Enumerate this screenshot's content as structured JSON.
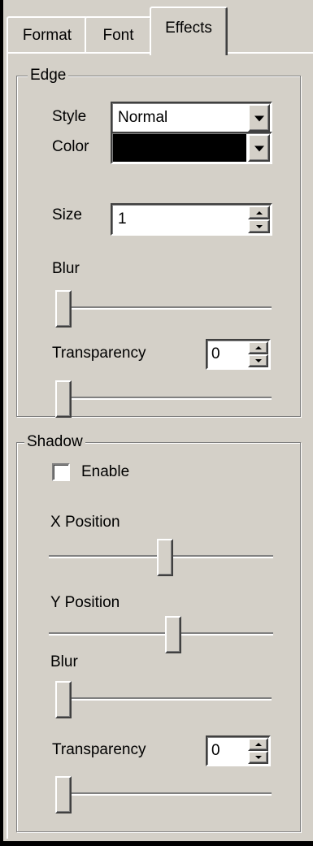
{
  "tabs": [
    {
      "label": "Format"
    },
    {
      "label": "Font"
    },
    {
      "label": "Effects"
    }
  ],
  "edge": {
    "title": "Edge",
    "style_label": "Style",
    "style_value": "Normal",
    "color_label": "Color",
    "color_value": "#000000",
    "size_label": "Size",
    "size_value": "1",
    "blur_label": "Blur",
    "blur_level": 0,
    "transparency_label": "Transparency",
    "transparency_value": "0",
    "transparency_level": 0
  },
  "shadow": {
    "title": "Shadow",
    "enable_label": "Enable",
    "enable_checked": false,
    "x_label": "X Position",
    "x_level": 0.52,
    "y_label": "Y Position",
    "y_level": 0.56,
    "blur_label": "Blur",
    "blur_level": 0,
    "transparency_label": "Transparency",
    "transparency_value": "0",
    "transparency_level": 0
  }
}
